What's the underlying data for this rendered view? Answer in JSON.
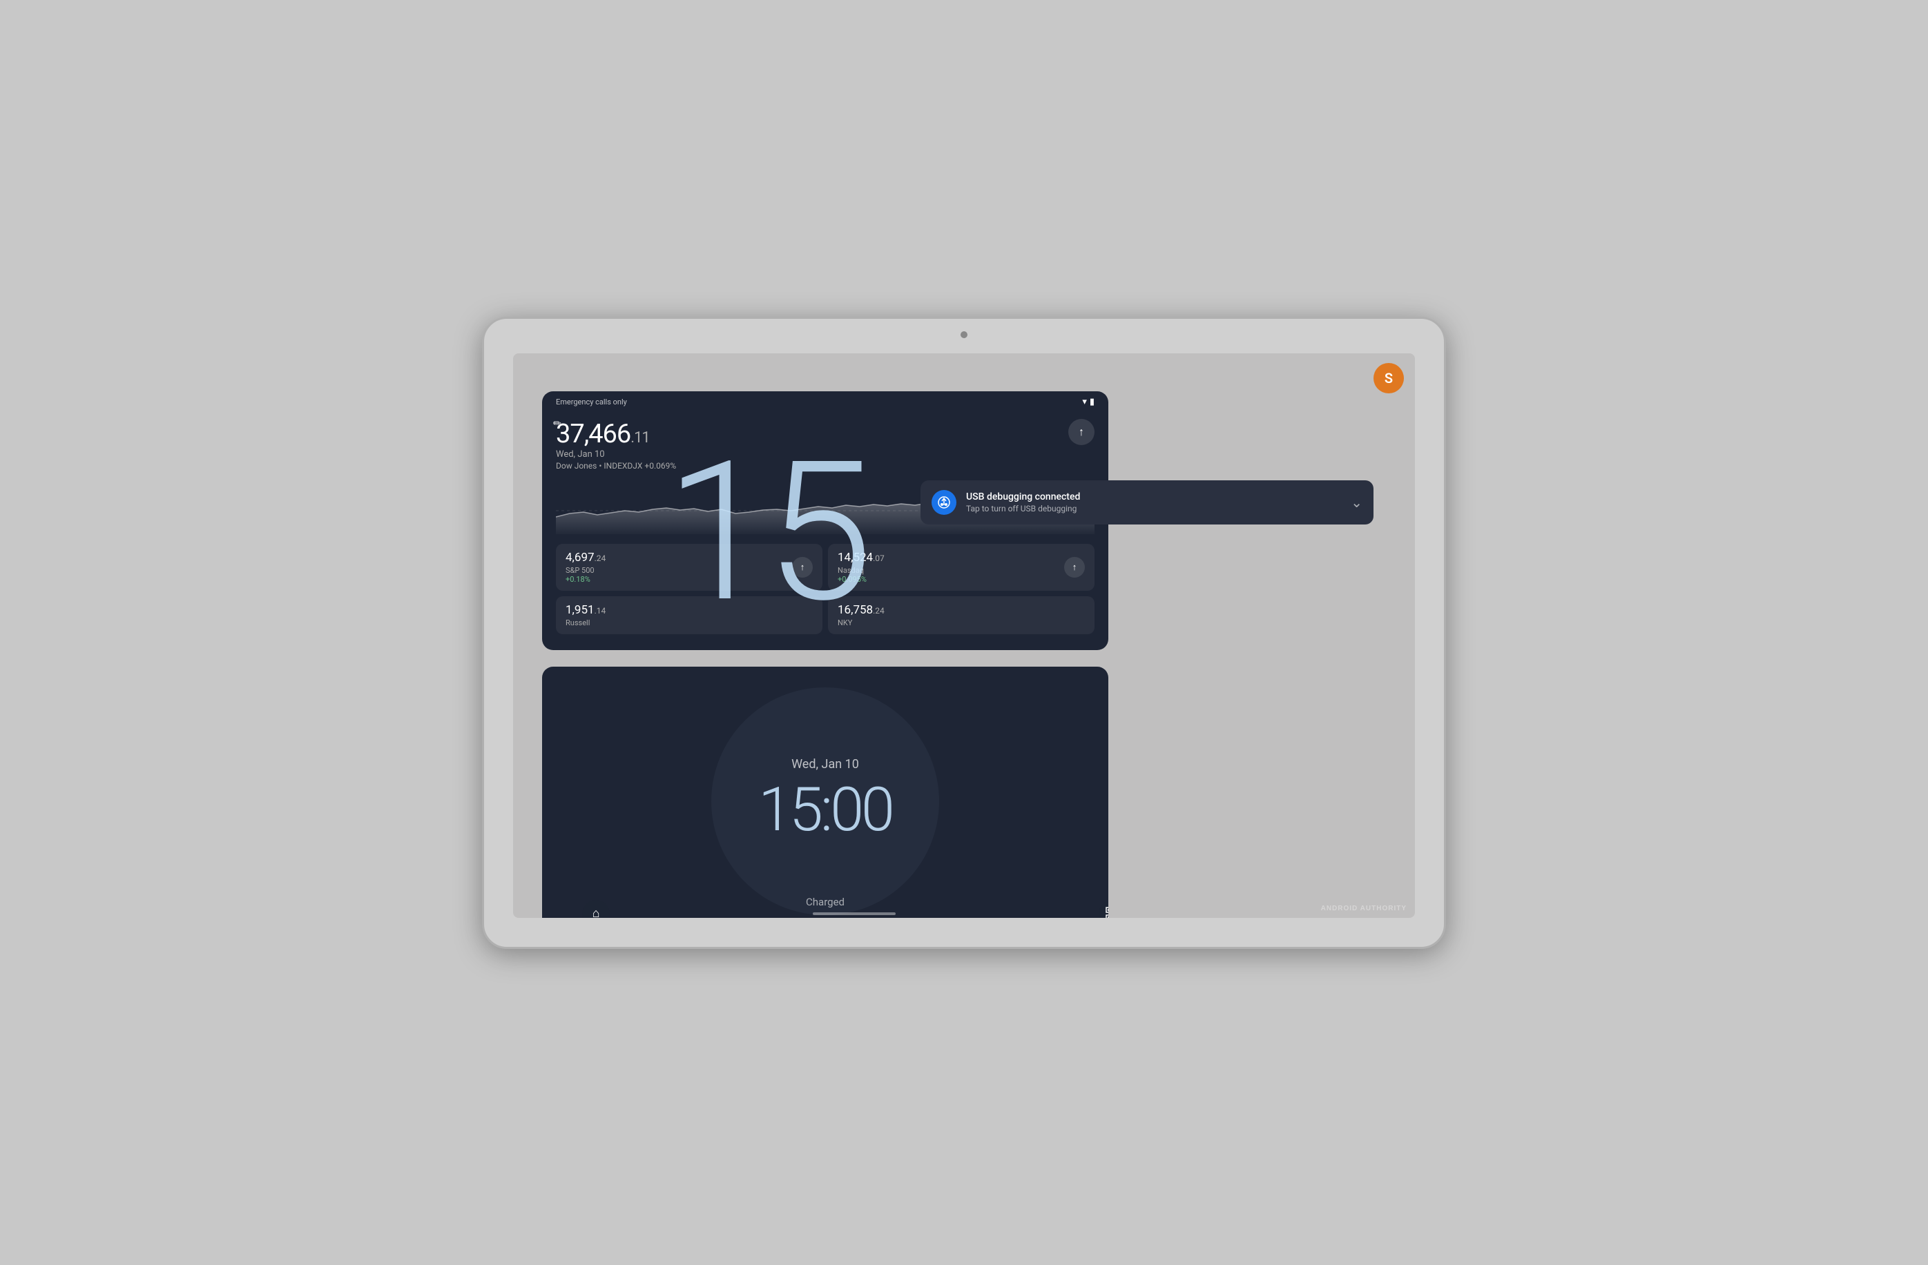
{
  "device": {
    "type": "tablet",
    "brand": "Android"
  },
  "status_bar": {
    "emergency_text": "Emergency calls only",
    "wifi_icon": "▾",
    "battery_icon": "▮"
  },
  "user_avatar": {
    "letter": "S",
    "bg_color": "#e07820"
  },
  "stocks_widget": {
    "main_price": "37,466",
    "main_decimal": ".11",
    "date": "Wed, Jan 10",
    "index": "Dow Jones • INDEXDJX +0.069%",
    "up_button": "↑",
    "sub_stocks": [
      {
        "price": "4,697",
        "decimal": ".24",
        "name": "S&P 500",
        "change": "+0.18%"
      },
      {
        "price": "14,524",
        "decimal": ".07",
        "name": "Nasdaq",
        "change": "+0.095%"
      },
      {
        "price": "1,951",
        "decimal": ".14",
        "name": "Russell",
        "change": ""
      },
      {
        "price": "16,758",
        "decimal": ".24",
        "name": "NKY",
        "change": ""
      }
    ]
  },
  "big_clock": {
    "time": "15"
  },
  "clock_widget": {
    "date": "Wed, Jan 10",
    "time": "15:00",
    "charged_label": "Charged"
  },
  "usb_notification": {
    "icon": "⟳",
    "title": "USB debugging connected",
    "subtitle": "Tap to turn off USB debugging",
    "expand_icon": "⌄"
  },
  "nav": {
    "home_icon": "⌂",
    "qr_icon": "▣"
  },
  "watermark": {
    "text": "ANDROID AUTHORITY"
  }
}
